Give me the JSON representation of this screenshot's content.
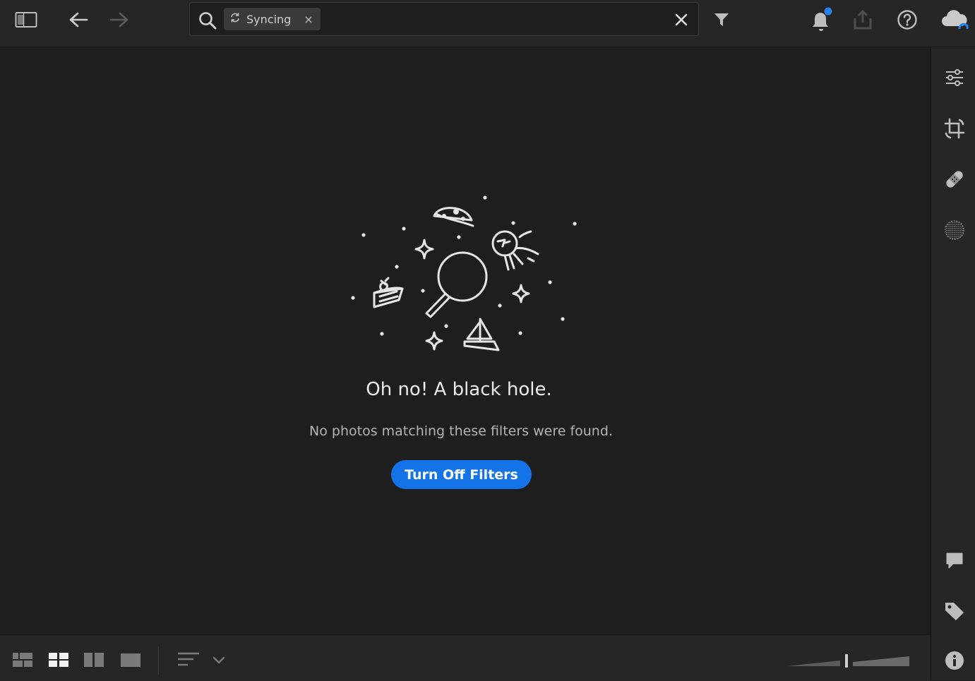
{
  "search": {
    "chip_label": "Syncing",
    "chip_close": "×"
  },
  "empty_state": {
    "title": "Oh no! A black hole.",
    "subtitle": "No photos matching these filters were found.",
    "button_label": "Turn Off Filters"
  },
  "colors": {
    "accent": "#1473e6",
    "notification_dot": "#2680eb",
    "background": "#1e1e1e",
    "panel": "#262626"
  },
  "icons": {
    "top": [
      "panel-toggle-icon",
      "back-arrow-icon",
      "forward-arrow-icon",
      "search-icon",
      "sync-icon",
      "clear-icon",
      "filter-icon",
      "bell-icon",
      "share-icon",
      "help-icon",
      "cloud-sync-icon"
    ],
    "right": [
      "edit-sliders-icon",
      "crop-icon",
      "heal-bandage-icon",
      "mask-icon",
      "comment-icon",
      "tag-icon",
      "info-icon"
    ],
    "bottom": [
      "square-grid-view-icon",
      "photo-grid-view-icon",
      "detail-view-icon",
      "single-view-icon",
      "sort-icon",
      "chevron-down-icon",
      "thumbnail-size-slider"
    ]
  }
}
